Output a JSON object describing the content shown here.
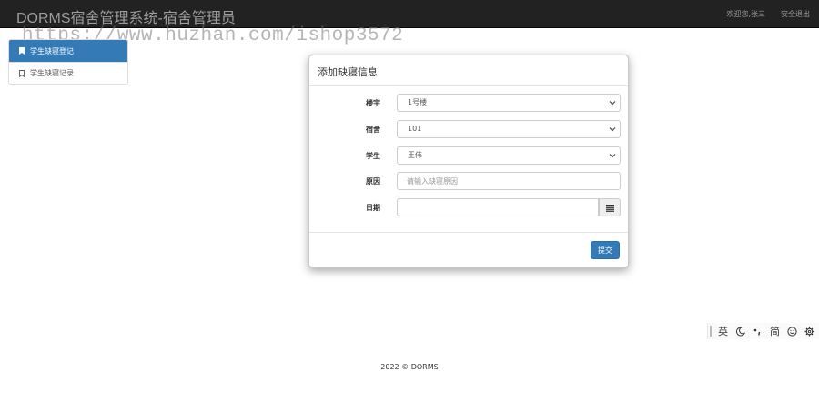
{
  "navbar": {
    "brand": "DORMS宿舍管理系统-宿舍管理员",
    "welcome": "欢迎您,张三",
    "logout": "安全退出"
  },
  "watermark": "https://www.huzhan.com/ishop3572",
  "sidebar": {
    "items": [
      {
        "label": "学生缺寝登记",
        "icon": "bookmark-filled-icon",
        "active": true
      },
      {
        "label": "学生缺寝记录",
        "icon": "bookmark-outline-icon",
        "active": false
      }
    ]
  },
  "modal": {
    "title": "添加缺寝信息",
    "fields": {
      "building": {
        "label": "楼宇",
        "value": "1号楼"
      },
      "dorm": {
        "label": "宿舍",
        "value": "101"
      },
      "student": {
        "label": "学生",
        "value": "王伟"
      },
      "reason": {
        "label": "原因",
        "placeholder": "请输入缺寝原因",
        "value": ""
      },
      "date": {
        "label": "日期",
        "value": "",
        "icon": "calendar-icon"
      }
    },
    "submit_label": "提交"
  },
  "ime_toolbar": {
    "mode_label": "英",
    "script_label": "简",
    "icons": [
      "moon-icon",
      "punctuation-icon",
      "smiley-icon",
      "gear-icon"
    ]
  },
  "footer": {
    "copyright": "2022 © DORMS"
  },
  "colors": {
    "navbar_bg": "#222222",
    "primary": "#337ab7",
    "text_muted": "#9d9d9d"
  }
}
